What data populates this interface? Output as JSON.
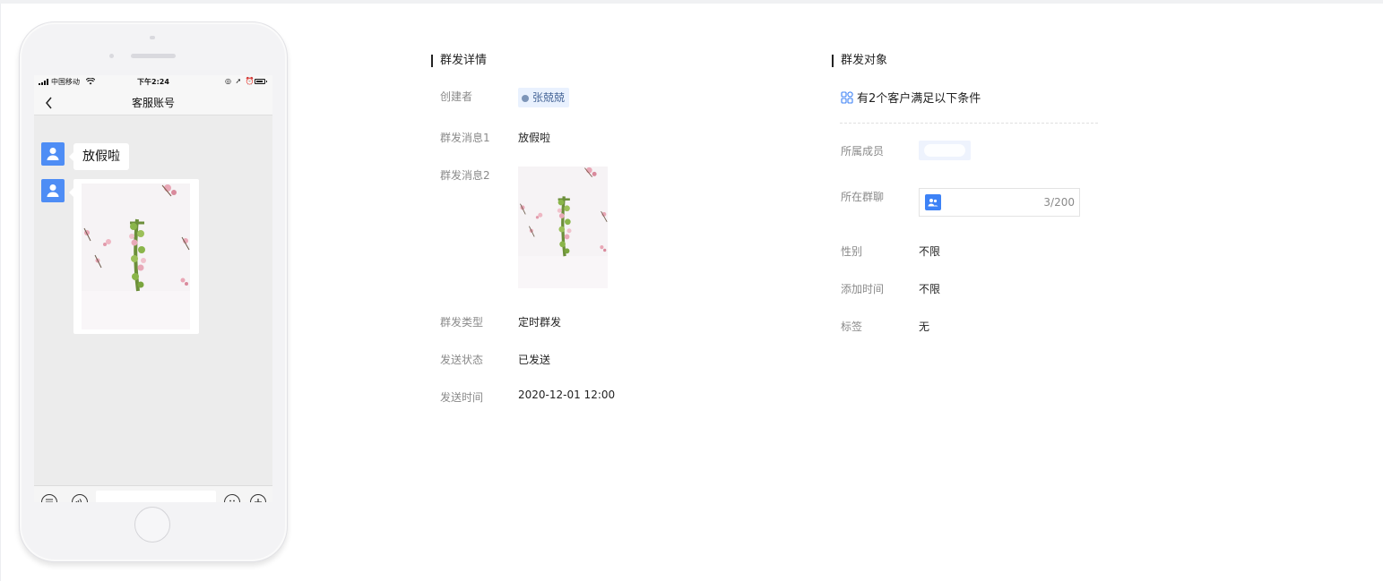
{
  "phone": {
    "status_bar": {
      "carrier": "中国移动",
      "time": "下午2:24",
      "icons": "◎ ➚ ⏰"
    },
    "nav": {
      "title": "客服账号"
    },
    "messages": [
      {
        "type": "text",
        "text": "放假啦"
      },
      {
        "type": "image"
      }
    ]
  },
  "detail": {
    "title": "群发详情",
    "creator_label": "创建者",
    "creator_name": "张兢兢",
    "message1_label": "群发消息1",
    "message1_value": "放假啦",
    "message2_label": "群发消息2",
    "type_label": "群发类型",
    "type_value": "定时群发",
    "status_label": "发送状态",
    "status_value": "已发送",
    "time_label": "发送时间",
    "time_value": "2020-12-01 12:00"
  },
  "target": {
    "title": "群发对象",
    "summary": "有2个客户满足以下条件",
    "member_label": "所属成员",
    "group_label": "所在群聊",
    "group_count": "3/200",
    "gender_label": "性别",
    "gender_value": "不限",
    "added_time_label": "添加时间",
    "added_time_value": "不限",
    "tag_label": "标签",
    "tag_value": "无"
  },
  "colors": {
    "accent": "#4e8df5",
    "tag_bg": "#e9f1fe",
    "label": "#8a8a8a"
  }
}
